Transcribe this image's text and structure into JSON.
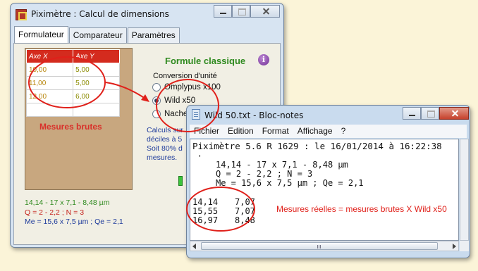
{
  "piximetre": {
    "title": "Piximètre : Calcul de dimensions",
    "tabs": [
      "Formulateur",
      "Comparateur",
      "Paramètres"
    ],
    "table": {
      "headers": [
        "Axe X",
        "Axe Y"
      ],
      "rows": [
        [
          "10,00",
          "5,00"
        ],
        [
          "11,00",
          "5,00"
        ],
        [
          "12,00",
          "6,00"
        ]
      ]
    },
    "raw_label": "Mesures brutes",
    "formula_title": "Formule classique",
    "info_glyph": "i",
    "conversion": {
      "title": "Conversion d'unité",
      "options": [
        "Omplypus x100",
        "Wild x50",
        "Nache"
      ],
      "selected": "Wild x50"
    },
    "calc_lines": [
      "Calculs sur",
      "déciles à 5",
      "Soit 80% d",
      "mesures."
    ],
    "results": {
      "line1": "14,14 - 17 x 7,1 - 8,48 µm",
      "line2": "Q = 2 - 2,2 ; N = 3",
      "line3": "Me = 15,6 x 7,5 µm ; Qe = 2,1"
    }
  },
  "notepad": {
    "title": "Wild 50.txt - Bloc-notes",
    "menu": [
      "Fichier",
      "Edition",
      "Format",
      "Affichage",
      "?"
    ],
    "header_line": "Piximètre 5.6 R 1629 : le 16/01/2014 à 16:22:38",
    "tick": "'",
    "summary": [
      "14,14 - 17 x 7,1 - 8,48 µm",
      "Q = 2 - 2,2 ; N = 3",
      "Me = 15,6 x 7,5 µm ; Qe = 2,1"
    ],
    "values": [
      [
        "14,14",
        "7,07"
      ],
      [
        "15,55",
        "7,07"
      ],
      [
        "16,97",
        "8,48"
      ]
    ]
  },
  "annotation": "Mesures réelles = mesures brutes X Wild x50",
  "colors": {
    "background": "#fbf4d8",
    "header_red": "#d42b1e",
    "green_text": "#2f8a1f",
    "blue_text": "#1d3a9b",
    "annotation_red": "#e0201a"
  },
  "icons": [
    "piximetre-app-icon",
    "minimize-icon",
    "maximize-icon",
    "close-icon",
    "info-icon",
    "notepad-icon"
  ]
}
